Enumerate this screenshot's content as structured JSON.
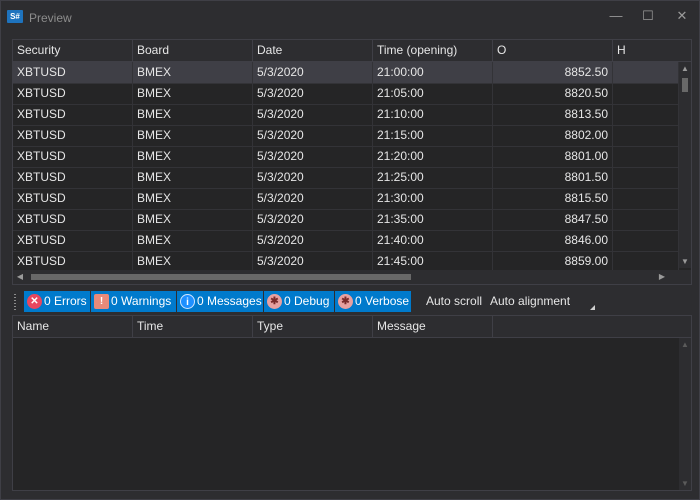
{
  "window": {
    "app_icon_text": "S#",
    "title": "Preview",
    "minimize_glyph": "—",
    "maximize_glyph": "☐",
    "close_glyph": "✕"
  },
  "grid": {
    "columns": [
      "Security",
      "Board",
      "Date",
      "Time (opening)",
      "O",
      "H"
    ],
    "rows": [
      [
        "XBTUSD",
        "BMEX",
        "5/3/2020",
        "21:00:00",
        "8852.50"
      ],
      [
        "XBTUSD",
        "BMEX",
        "5/3/2020",
        "21:05:00",
        "8820.50"
      ],
      [
        "XBTUSD",
        "BMEX",
        "5/3/2020",
        "21:10:00",
        "8813.50"
      ],
      [
        "XBTUSD",
        "BMEX",
        "5/3/2020",
        "21:15:00",
        "8802.00"
      ],
      [
        "XBTUSD",
        "BMEX",
        "5/3/2020",
        "21:20:00",
        "8801.00"
      ],
      [
        "XBTUSD",
        "BMEX",
        "5/3/2020",
        "21:25:00",
        "8801.50"
      ],
      [
        "XBTUSD",
        "BMEX",
        "5/3/2020",
        "21:30:00",
        "8815.50"
      ],
      [
        "XBTUSD",
        "BMEX",
        "5/3/2020",
        "21:35:00",
        "8847.50"
      ],
      [
        "XBTUSD",
        "BMEX",
        "5/3/2020",
        "21:40:00",
        "8846.00"
      ],
      [
        "XBTUSD",
        "BMEX",
        "5/3/2020",
        "21:45:00",
        "8859.00"
      ]
    ]
  },
  "log_toolbar": {
    "errors": "0 Errors",
    "warnings": "0 Warnings",
    "messages": "0 Messages",
    "debug": "0 Debug",
    "verbose": "0 Verbose",
    "auto_scroll": "Auto scroll",
    "auto_alignment": "Auto alignment",
    "error_icon_glyph": "✕",
    "warning_icon_glyph": "!",
    "info_icon_glyph": "i",
    "bug_icon_glyph": "✱"
  },
  "log_grid": {
    "columns": [
      "Name",
      "Time",
      "Type",
      "Message"
    ]
  },
  "colors": {
    "accent": "#007acc",
    "error": "#e8475f",
    "warning": "#f0a30a",
    "info": "#1e90ff",
    "bug": "#e8a0a0"
  }
}
